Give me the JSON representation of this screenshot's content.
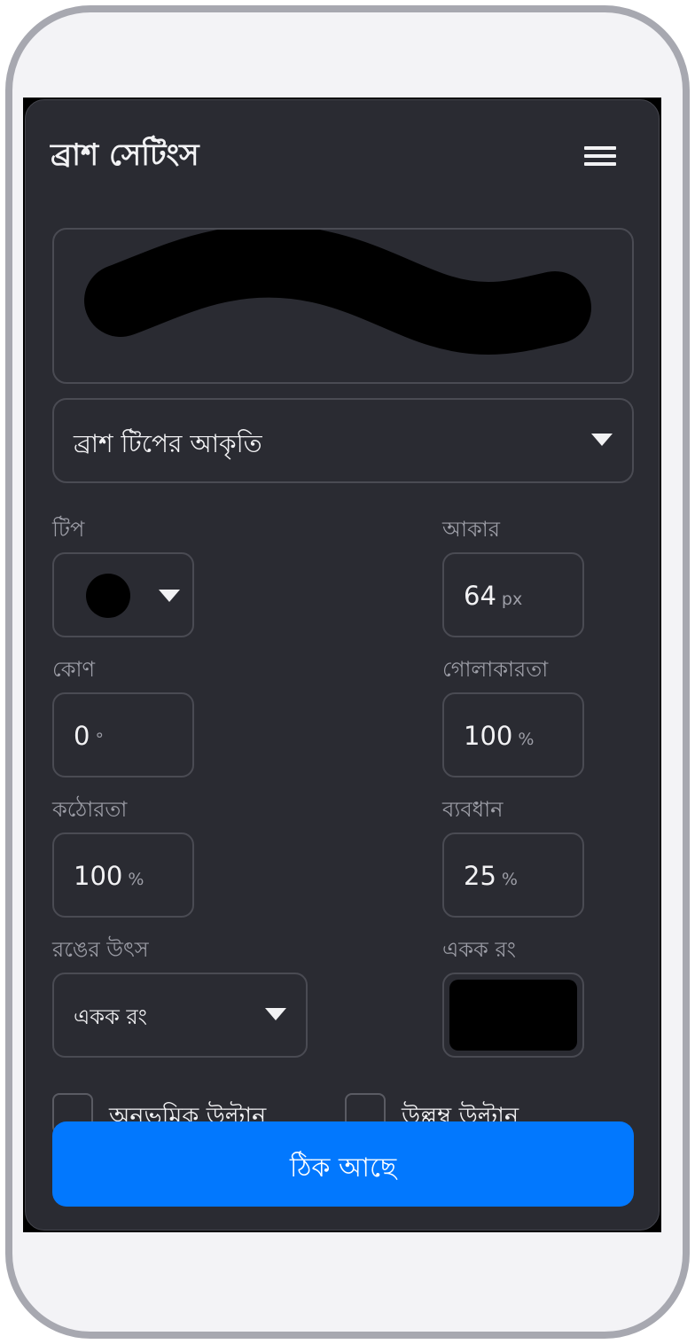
{
  "dialog": {
    "title": "ব্রাশ সেটিংস",
    "menu_icon": "hamburger-menu-icon"
  },
  "preview": {
    "stroke_color": "#000000"
  },
  "shape_select": {
    "label": "ব্রাশ টিপের আকৃতি"
  },
  "fields": {
    "tip": {
      "label": "টিপ",
      "icon": "round-brush-tip-icon"
    },
    "size": {
      "label": "আকার",
      "value": "64",
      "unit": "px"
    },
    "angle": {
      "label": "কোণ",
      "value": "0",
      "unit": "°"
    },
    "roundness": {
      "label": "গোলাকারতা",
      "value": "100",
      "unit": "%"
    },
    "hardness": {
      "label": "কঠোরতা",
      "value": "100",
      "unit": "%"
    },
    "spacing": {
      "label": "ব্যবধান",
      "value": "25",
      "unit": "%"
    },
    "color_source": {
      "label": "রঙের উৎস",
      "value": "একক রং"
    },
    "solid_color": {
      "label": "একক রং",
      "color": "#000000"
    }
  },
  "checkboxes": {
    "flip_horizontal": {
      "label": "অনুভূমিক উল্টান",
      "checked": false
    },
    "flip_vertical": {
      "label": "উল্লম্ব উল্টান",
      "checked": false
    }
  },
  "ok_button": {
    "label": "ঠিক আছে"
  },
  "colors": {
    "accent": "#0278fe",
    "panel_bg": "#2a2b32",
    "border": "#4a4b53",
    "frame": "#a7a8b0"
  }
}
